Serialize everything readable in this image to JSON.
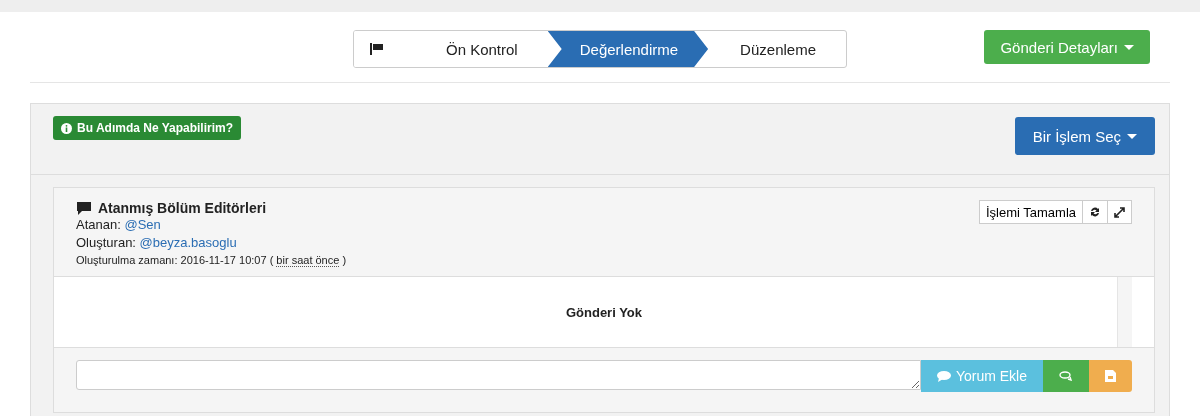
{
  "steps": [
    {
      "label": "Ön Kontrol",
      "selected": false
    },
    {
      "label": "Değerlendirme",
      "selected": true
    },
    {
      "label": "Düzenleme",
      "selected": false
    }
  ],
  "details_button": "Gönderi Detayları",
  "help_button": "Bu Adımda Ne Yapabilirim?",
  "action_button": "Bir İşlem Seç",
  "task": {
    "title": "Atanmış Bölüm Editörleri",
    "assigned_label": "Atanan:",
    "assigned_user": "@Sen",
    "creator_label": "Oluşturan:",
    "creator_user": "@beyza.basoglu",
    "created_label": "Oluşturulma zamanı: 2016-11-17 10:07 (",
    "created_relative": "bir saat önce",
    "created_end": ")",
    "complete_button": "İşlemi Tamamla",
    "empty_text": "Gönderi Yok",
    "comment_button": "Yorum Ekle"
  }
}
